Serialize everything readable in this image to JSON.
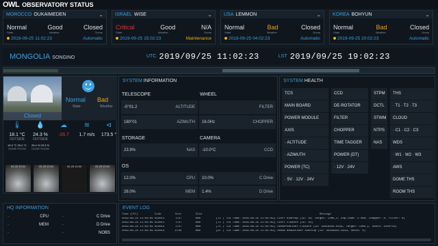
{
  "app": {
    "logo": "OWL",
    "title": "OBSERVATORY STATUS"
  },
  "observatories": [
    {
      "country": "MOROCCO",
      "site": "OUKAIMEDEN",
      "state": "Normal",
      "weather": "Good",
      "dome": "Closed",
      "date": "2019-09-25",
      "time": "11:02:23",
      "mode": "Automatic",
      "state_color": "#dde3ea",
      "weather_color": "#dde3ea"
    },
    {
      "country": "ISRAEL",
      "site": "WISE",
      "state": "Critical",
      "weather": "Good",
      "dome": "N/A",
      "date": "2019-09-25",
      "time": "15:02:23",
      "mode": "Maintenance",
      "state_color": "#e33333",
      "weather_color": "#dde3ea"
    },
    {
      "country": "USA",
      "site": "LEMMON",
      "state": "Normal",
      "weather": "Bad",
      "dome": "Closed",
      "date": "2019-09-25",
      "time": "04:02:23",
      "mode": "Automatic",
      "state_color": "#dde3ea",
      "weather_color": "#f0a020"
    },
    {
      "country": "KOREA",
      "site": "BOHYUN",
      "state": "Normal",
      "weather": "Bad",
      "dome": "Closed",
      "date": "2019-09-25",
      "time": "20:02:23",
      "mode": "Automatic",
      "state_color": "#dde3ea",
      "weather_color": "#f0a020"
    }
  ],
  "captions": {
    "state": "State",
    "weather": "Weather",
    "dome": "Dome"
  },
  "current": {
    "country": "MONGOLIA",
    "site": "SONGINO"
  },
  "utc": {
    "label": "UTC",
    "y": "2019",
    "m": "09",
    "d": "25",
    "hh": "11",
    "mm": "02",
    "ss": "23"
  },
  "lst": {
    "label": "LST",
    "y": "2019",
    "m": "09",
    "d": "25",
    "hh": "19",
    "mm": "02",
    "ss": "23"
  },
  "site_panel": {
    "dome": "Closed",
    "state": "Normal",
    "weather": "Bad",
    "state_cap": "State",
    "weather_cap": "Weather",
    "sensors": [
      {
        "val": "18.1",
        "unit": "°C",
        "cap": "OUTSIDE",
        "sub": "19.0 °C   25.4 °C",
        "subcap": "DOME   ROOM",
        "icon": "thermometer-icon"
      },
      {
        "val": "24.3",
        "unit": "%",
        "cap": "OUTSIDE",
        "sub": "25.4 %   29.3 %",
        "subcap": "DOME   ROOM",
        "icon": "humidity-icon"
      },
      {
        "val": "-26.7",
        "unit": "",
        "cap": "",
        "sub": "",
        "subcap": "",
        "icon": "cloud-icon"
      },
      {
        "val": "1.7",
        "unit": "m/s",
        "cap": "",
        "sub": "",
        "subcap": "",
        "icon": "wind-icon"
      },
      {
        "val": "173.5",
        "unit": "°",
        "cap": "",
        "sub": "",
        "subcap": "",
        "icon": "direction-icon"
      }
    ],
    "cams": [
      "09-25 19:00",
      "09-25 19:00",
      "09-25 19:00",
      "09-25 19:00"
    ]
  },
  "sysinfo": {
    "title_a": "SYSTEM",
    "title_b": "INFORMATION",
    "telescope": "TELESCOPE",
    "wheel": "WHEEL",
    "storage": "STORAGE",
    "camera": "CAMERA",
    "os": "OS",
    "tel_rows": [
      {
        "v": "-0°01.2",
        "l": "ALTITUDE"
      },
      {
        "v": "180°01",
        "l": "AZIMUTH"
      }
    ],
    "wheel_rows": [
      {
        "v": "",
        "l": "FILTER"
      },
      {
        "v": "16.0Hz",
        "l": "CHOPPER"
      }
    ],
    "storage_row": {
      "v": "23.9%",
      "l": "NAS"
    },
    "camera_row": {
      "v": "-10.0°C",
      "l": "CCD"
    },
    "os_rows": [
      {
        "v": "12.0%",
        "l": "CPU",
        "v2": "10.0%",
        "l2": "C Drive"
      },
      {
        "v": "28.0%",
        "l": "MEM",
        "v2": "1.4%",
        "l2": "D Drive"
      }
    ]
  },
  "syshealth": {
    "title_a": "SYSTEM",
    "title_b": "HEALTH",
    "col1": [
      "TCS",
      "MAIN BOARD",
      "POWER MODULE",
      "AXIS",
      "· ALTITUDE",
      "· AZIMUTH",
      "POWER (TC)",
      "· 5V  · 12V  · 24V"
    ],
    "col2": [
      "CCD",
      "DE-ROTATOR",
      "FILTER",
      "CHOPPER",
      "TIME TAGGER",
      "POWER (DT)",
      "· 12V  · 24V"
    ],
    "col3": [
      "STPM",
      "DCTL",
      "STWM",
      "NTPS",
      "NAS"
    ],
    "col4": [
      "THS",
      "· T1  · T2  · T3",
      "CLOUD",
      "· C1  · C2  · C3",
      "WDS",
      "· W1  · W2  · W3",
      "AWS",
      "DOME THS",
      "ROOM THS"
    ]
  },
  "hq": {
    "title": "HQ INFORMATION",
    "rows": [
      {
        "a": "CPU",
        "b": "C Drive"
      },
      {
        "a": "MEM",
        "b": "D Drive"
      },
      {
        "a": "",
        "b": "NOBS"
      }
    ]
  },
  "eventlog": {
    "title": "EVENT LOG",
    "headers": [
      "Time (UTC)",
      "Code",
      "Unit",
      "Site",
      "Message"
    ],
    "rows": [
      [
        "2019-09-25 11:02:09",
        "SO2011",
        "TCST",
        "KMS",
        "[TC | TCS Time: 2019-09-25 11:02:09] <Inf> Startup (ID: 10, Target: COMS_1, Exp-time: 2.000, Chopper: 0, Filter: 0)"
      ],
      [
        "2019-09-25 11:02:09",
        "SO2011",
        "TCST",
        "KMS",
        "[TC | TCS Time: 2019-09-25 11:02:09] <Inf> Closure (ID: 10)"
      ],
      [
        "2019-09-25 11:02:09",
        "SO2012",
        "TCST",
        "KMS",
        "[TC | TCS Time: 2019-09-25 11:02:09] <Observation> Closure (ID: 42819935-5019, Target: COMS_1, Shots: 10x0+10)"
      ],
      [
        "2019-09-25 11:02:09",
        "SO2013",
        "DTSS",
        "KMS",
        "[DT | TCS Time: 2019-09-25 11:02:09] <Data Reduction> Startup (ID: 42819935-5019, Shots: 0)"
      ]
    ]
  }
}
